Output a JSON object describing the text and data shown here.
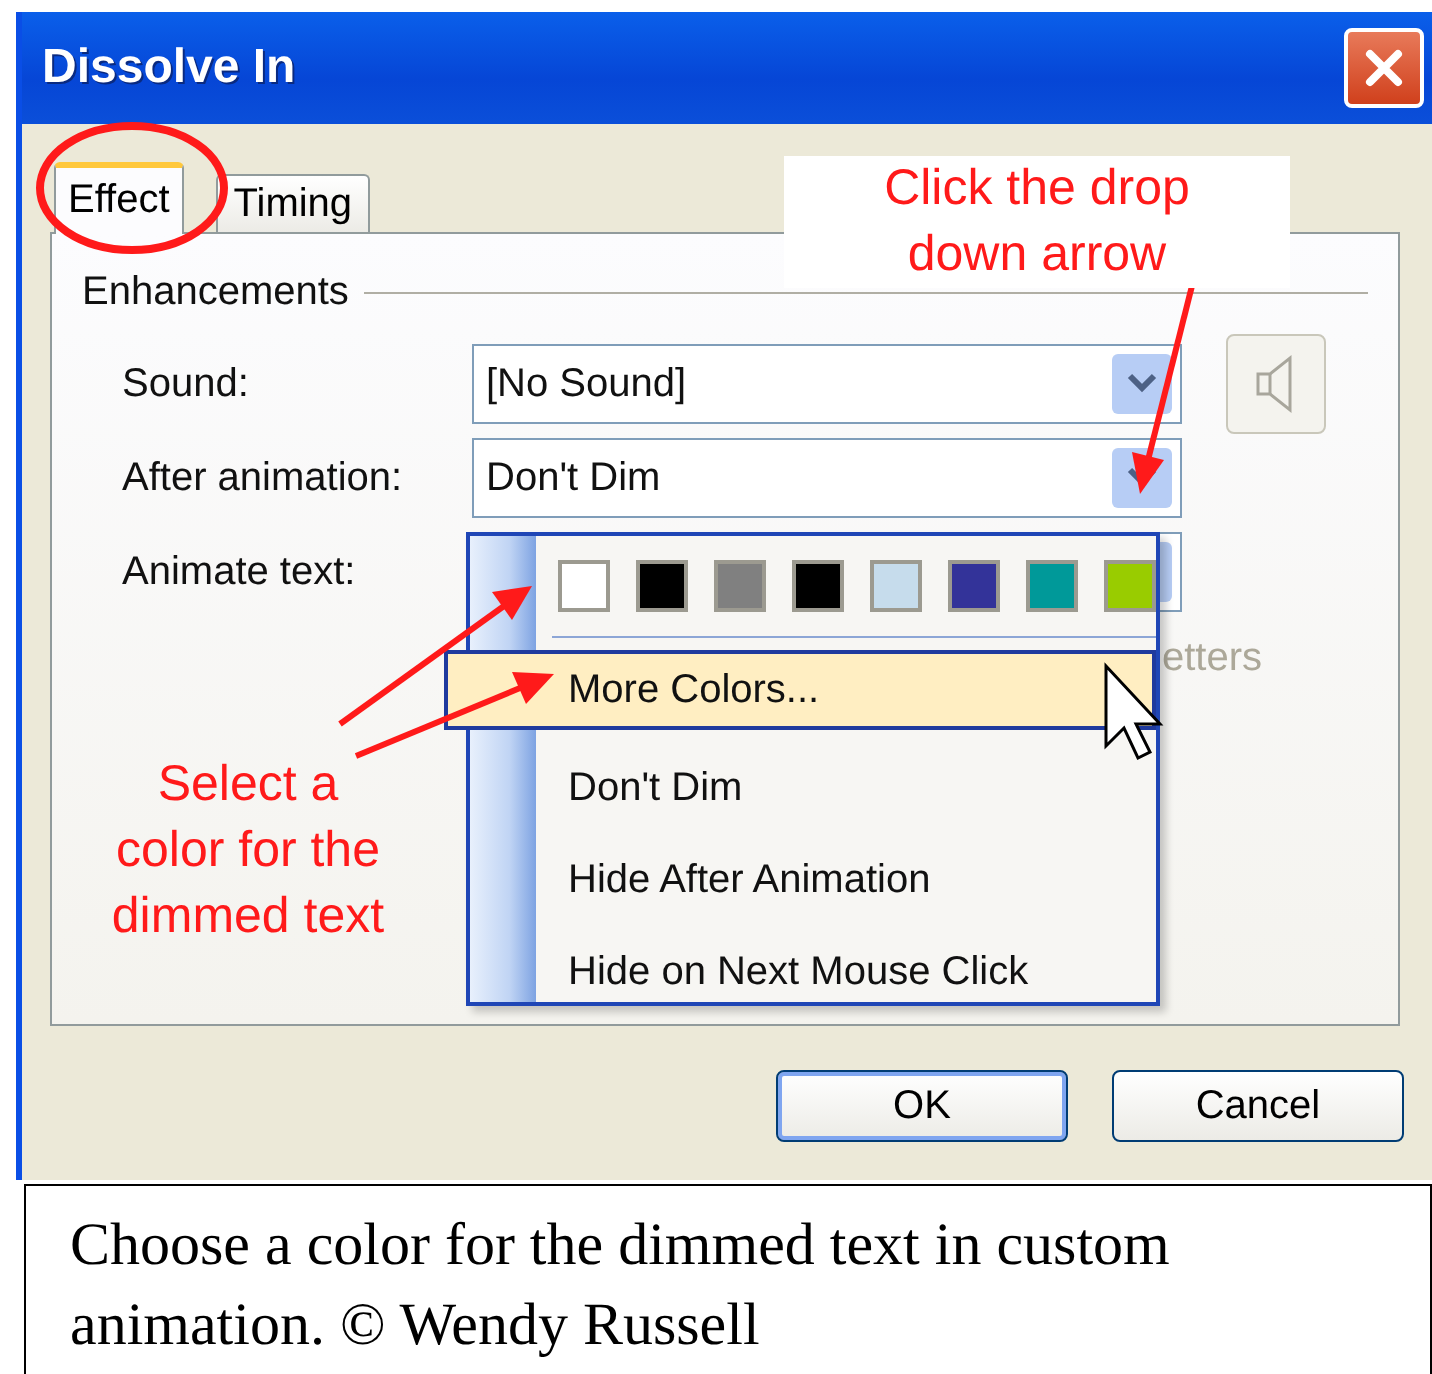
{
  "window": {
    "title": "Dissolve In"
  },
  "tabs": [
    {
      "label": "Effect",
      "selected": true
    },
    {
      "label": "Timing",
      "selected": false
    }
  ],
  "group": {
    "title": "Enhancements"
  },
  "fields": [
    {
      "label": "Sound:",
      "value": "[No Sound]"
    },
    {
      "label": "After animation:",
      "value": "Don't Dim"
    },
    {
      "label": "Animate text:"
    }
  ],
  "hidden_option": {
    "text": "etters",
    "disabled": true
  },
  "menu": {
    "swatches": [
      {
        "color": "#ffffff"
      },
      {
        "color": "#000000"
      },
      {
        "color": "#808080"
      },
      {
        "color": "#000000"
      },
      {
        "color": "#c6dcec"
      },
      {
        "color": "#333399"
      },
      {
        "color": "#009999"
      },
      {
        "color": "#99cc00"
      }
    ],
    "items": [
      {
        "label": "More Colors...",
        "selected": true
      },
      {
        "label": "Don't Dim",
        "selected": false
      },
      {
        "label": "Hide After Animation",
        "selected": false
      },
      {
        "label": "Hide on Next Mouse Click",
        "selected": false
      }
    ]
  },
  "buttons": [
    {
      "label": "OK",
      "default": true
    },
    {
      "label": "Cancel",
      "default": false
    }
  ],
  "annotations": [
    {
      "text": "Click the drop\ndown arrow",
      "boxed": true
    },
    {
      "text": "Select a\ncolor for the\ndimmed text",
      "boxed": false
    }
  ],
  "caption": "Choose a color for the dimmed text in custom animation. © Wendy Russell"
}
